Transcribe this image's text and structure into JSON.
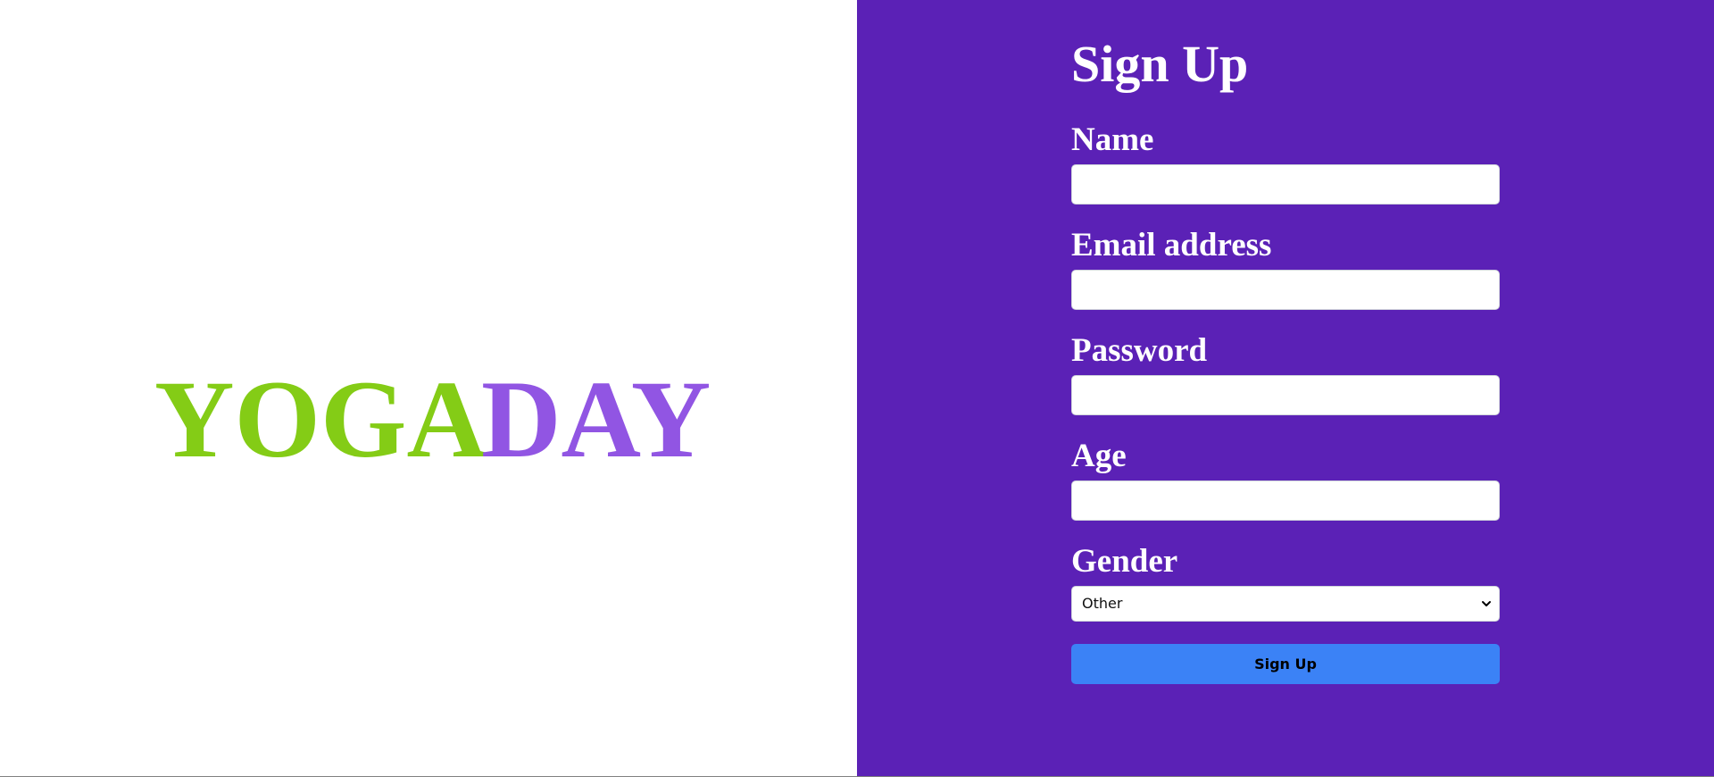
{
  "brand": {
    "logo_part_a": "YOGA",
    "logo_part_b": "DAY",
    "color_part_a": "#84cc16",
    "color_part_b": "#9155e3"
  },
  "form": {
    "title": "Sign Up",
    "fields": [
      {
        "label": "Name",
        "value": ""
      },
      {
        "label": "Email address",
        "value": ""
      },
      {
        "label": "Password",
        "value": ""
      },
      {
        "label": "Age",
        "value": ""
      }
    ],
    "gender": {
      "label": "Gender",
      "selected": "Other"
    },
    "submit_label": "Sign Up"
  },
  "colors": {
    "panel_background": "#5b21b6",
    "button_background": "#3b82f6"
  },
  "icons": {
    "select_chevron": "chevron-down-icon"
  }
}
